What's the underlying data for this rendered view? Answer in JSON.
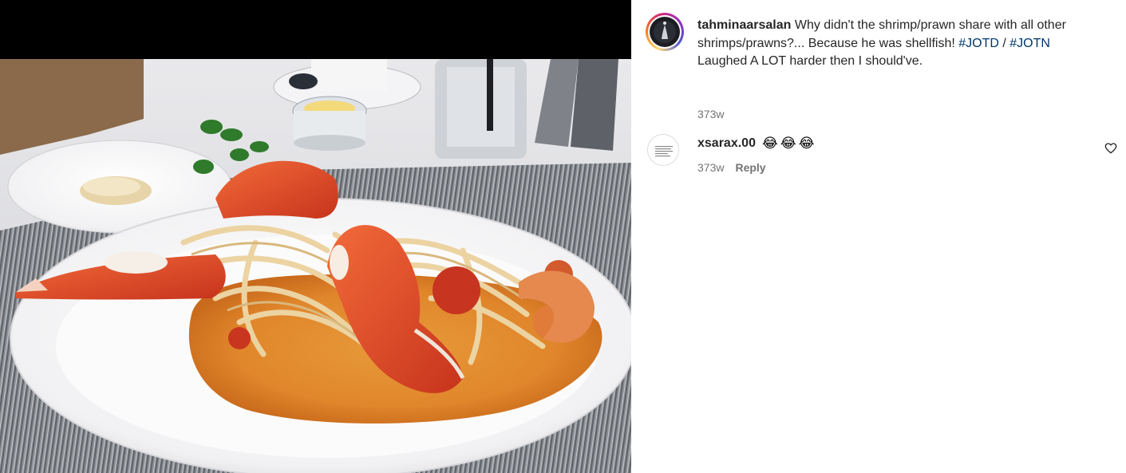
{
  "post": {
    "username": "tahminaarsalan",
    "caption_text": " Why didn't the shrimp/prawn share with all other shrimps/prawns?... Because he was shellfish! ",
    "hashtag1": "#JOTD",
    "separator": " / ",
    "hashtag2": "#JOTN",
    "caption_line2": "Laughed A LOT harder then I should've.",
    "time": "373w"
  },
  "comment": {
    "username": "xsarax.00",
    "text": "😂😂😂",
    "time": "373w",
    "reply_label": "Reply",
    "like_icon": "heart-outline-icon"
  },
  "colors": {
    "hashtag": "#00376b",
    "muted": "#737373",
    "text": "#262626"
  }
}
